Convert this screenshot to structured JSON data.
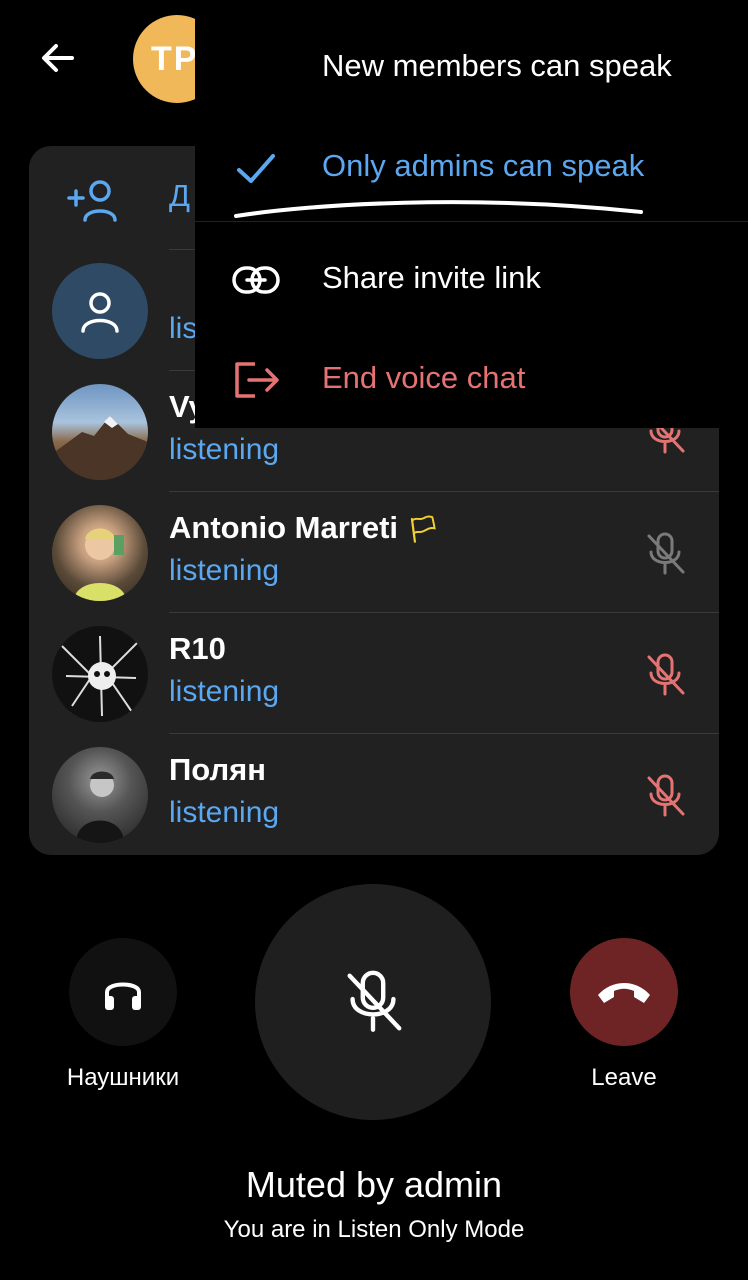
{
  "header": {
    "group_initials": "TP"
  },
  "invite": {
    "label": "Д"
  },
  "participants": [
    {
      "name": "",
      "status": "lis"
    },
    {
      "name": "Vy",
      "status": "listening"
    },
    {
      "name": "Antonio Marreti",
      "status": "listening",
      "emoji": "🏳"
    },
    {
      "name": "R10",
      "status": "listening"
    },
    {
      "name": "Полян",
      "status": "listening"
    }
  ],
  "menu": {
    "items": [
      {
        "label": "New members can speak"
      },
      {
        "label": "Only admins can speak",
        "checked": true
      },
      {
        "label": "Share invite link"
      },
      {
        "label": "End voice chat"
      }
    ]
  },
  "controls": {
    "audio_label": "Наушники",
    "leave_label": "Leave"
  },
  "status": {
    "title": "Muted by admin",
    "subtitle": "You are in Listen Only Mode"
  },
  "colors": {
    "accent": "#5ba7f0",
    "danger": "#e57373",
    "leave_bg": "#6e2424",
    "panel_bg": "#212121"
  }
}
